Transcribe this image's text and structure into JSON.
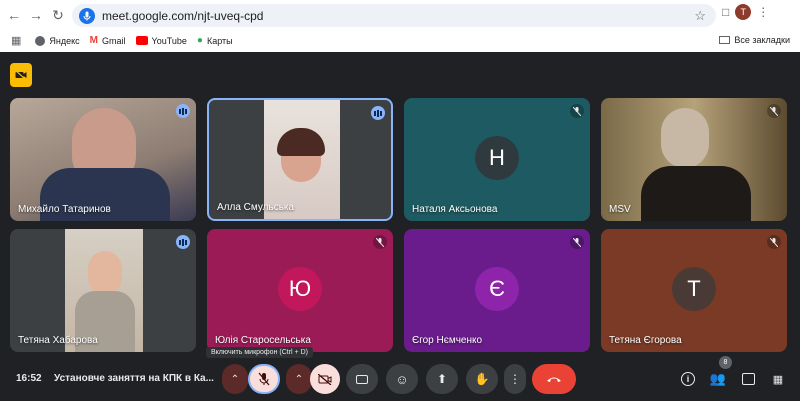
{
  "browser": {
    "url": "meet.google.com/njt-uveq-cpd",
    "profile_initial": "T",
    "bookmarks": [
      {
        "label": "Яндекс"
      },
      {
        "label": "Gmail"
      },
      {
        "label": "YouTube"
      },
      {
        "label": "Карты"
      }
    ],
    "all_bookmarks": "Все закладки"
  },
  "participants": [
    {
      "name": "Михайло Татаринов"
    },
    {
      "name": "Алла Смульська"
    },
    {
      "name": "Наталя Аксьонова",
      "initial": "Н"
    },
    {
      "name": "MSV"
    },
    {
      "name": "Тетяна Хабарова"
    },
    {
      "name": "Юлія Старосельська",
      "initial": "Ю"
    },
    {
      "name": "Єгор Нємченко",
      "initial": "Є"
    },
    {
      "name": "Тетяна Єгорова",
      "initial": "Т"
    }
  ],
  "tooltip": "Включить микрофон (Ctrl + D)",
  "bottom": {
    "time": "16:52",
    "meeting_title": "Установче заняття на КПК в Ка...",
    "participant_count": "8"
  },
  "colors": {
    "background": "#202124",
    "speaking": "#8ab4f8",
    "end_call": "#ea4335",
    "teal": "#1e5a61",
    "magenta": "#9b1b57",
    "purple": "#6a1c8c",
    "brown": "#7a3a25"
  }
}
